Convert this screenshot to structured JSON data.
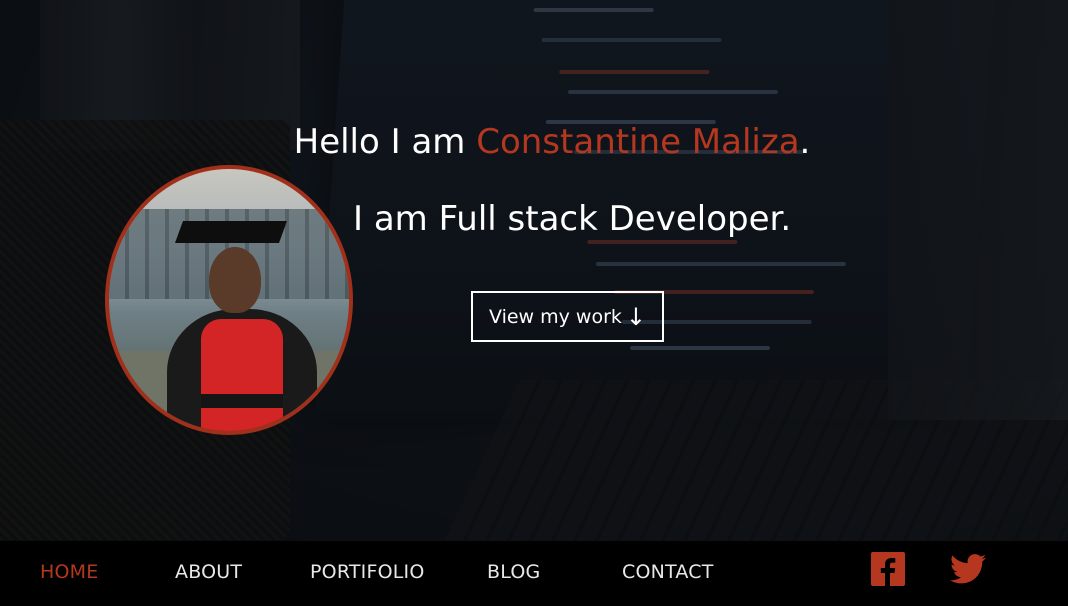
{
  "hero": {
    "greeting_prefix": "Hello I am",
    "name": "Constantine Maliza",
    "greeting_suffix": ".",
    "role": "I am Full stack Developer.",
    "cta_label": "View my work",
    "cta_icon": "arrow-down-icon"
  },
  "nav": {
    "items": [
      {
        "label": "HOME",
        "active": true
      },
      {
        "label": "ABOUT",
        "active": false
      },
      {
        "label": "PORTIFOLIO",
        "active": false
      },
      {
        "label": "BLOG",
        "active": false
      },
      {
        "label": "CONTACT",
        "active": false
      }
    ],
    "social": [
      {
        "icon": "facebook-icon"
      },
      {
        "icon": "twitter-icon"
      }
    ]
  },
  "colors": {
    "accent": "#b5371f",
    "nav_background": "#000000",
    "text": "#ffffff"
  }
}
